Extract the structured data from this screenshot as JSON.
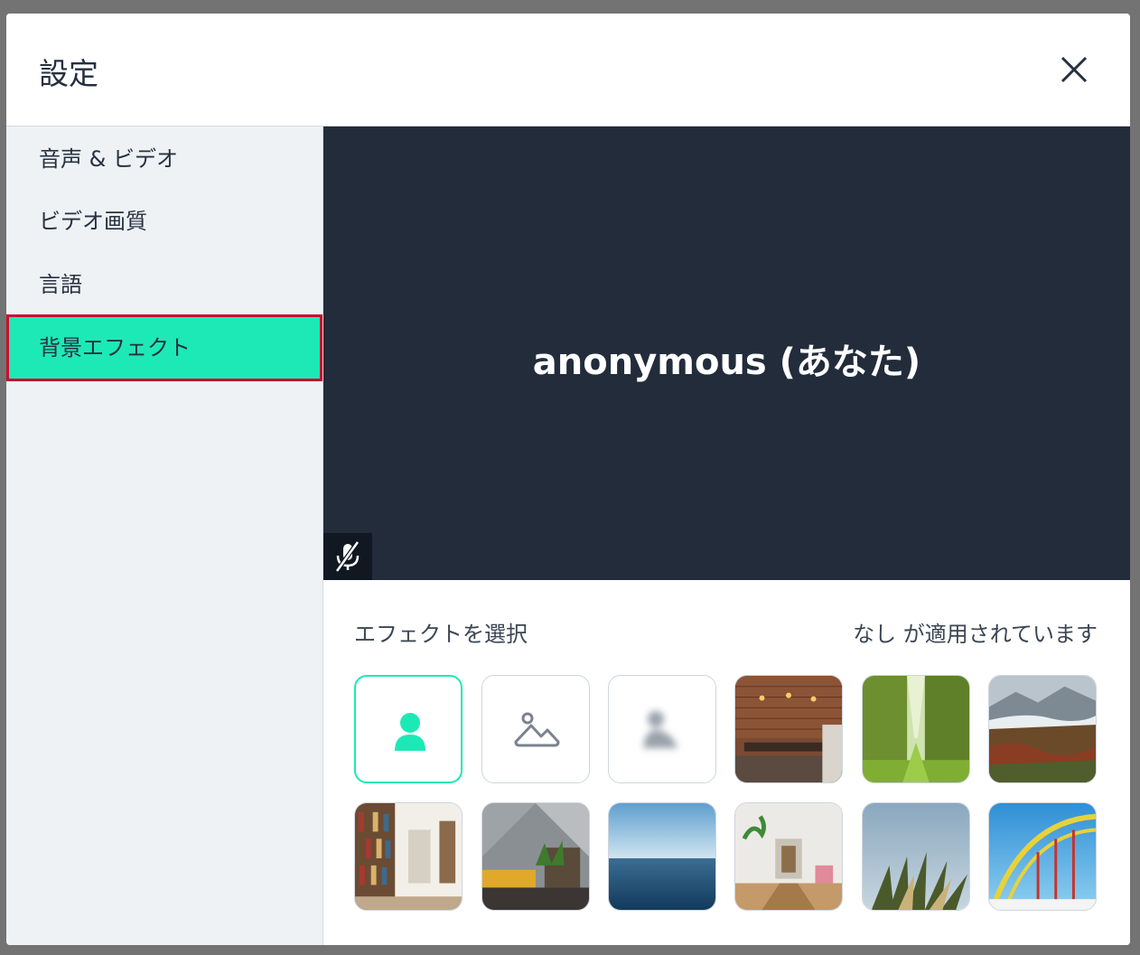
{
  "modal": {
    "title": "設定",
    "close_label": "close"
  },
  "sidebar": {
    "items": [
      {
        "label": "音声 & ビデオ",
        "active": false
      },
      {
        "label": "ビデオ画質",
        "active": false
      },
      {
        "label": "言語",
        "active": false
      },
      {
        "label": "背景エフェクト",
        "active": true
      }
    ]
  },
  "preview": {
    "participant_name": "anonymous (あなた)",
    "mic_icon": "mic-off-icon"
  },
  "effects": {
    "label": "エフェクトを選択",
    "status": "なし が適用されています",
    "options": [
      {
        "icon": "person-icon",
        "selected": true
      },
      {
        "icon": "background-image-icon",
        "selected": false
      },
      {
        "icon": "blur-icon",
        "selected": false
      },
      {
        "icon": "brick-wall-room-thumbnail",
        "selected": false
      },
      {
        "icon": "tree-lined-path-thumbnail",
        "selected": false
      },
      {
        "icon": "mountain-autumn-thumbnail",
        "selected": false
      },
      {
        "icon": "library-bookshelf-thumbnail",
        "selected": false
      },
      {
        "icon": "living-room-plant-thumbnail",
        "selected": false
      },
      {
        "icon": "ocean-horizon-thumbnail",
        "selected": false
      },
      {
        "icon": "bright-hallway-thumbnail",
        "selected": false
      },
      {
        "icon": "palm-leaves-sky-thumbnail",
        "selected": false
      },
      {
        "icon": "rollercoaster-sky-thumbnail",
        "selected": false
      }
    ]
  },
  "colors": {
    "accent": "#1de9b6",
    "highlight_border": "#c6102e",
    "preview_bg": "#222c3b",
    "sidebar_bg": "#eef2f5"
  }
}
